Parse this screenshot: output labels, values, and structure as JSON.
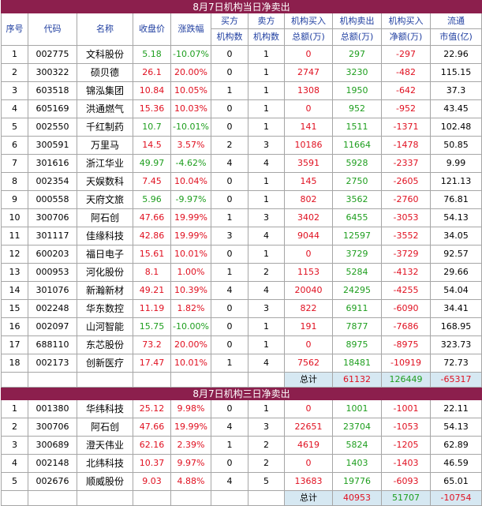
{
  "table1": {
    "title": "8月7日机构当日净卖出",
    "headers": {
      "seq": "序号",
      "code": "代码",
      "name": "名称",
      "close": "收盘价",
      "change": "涨跌幅",
      "buyers_top": "买方",
      "buyers_bot": "机构数",
      "sellers_top": "卖方",
      "sellers_bot": "机构数",
      "buy_amt_top": "机构买入",
      "buy_amt_bot": "总额(万)",
      "sell_amt_top": "机构卖出",
      "sell_amt_bot": "总额(万)",
      "net_top": "机构买入",
      "net_bot": "净额(万)",
      "cap_top": "流通",
      "cap_bot": "市值(亿)"
    },
    "rows": [
      {
        "seq": "1",
        "code": "002775",
        "name": "文科股份",
        "close": "5.18",
        "change": "-10.07%",
        "dir": "down",
        "buyers": "0",
        "sellers": "1",
        "buy": "0",
        "sell": "297",
        "net": "-297",
        "cap": "22.96"
      },
      {
        "seq": "2",
        "code": "300322",
        "name": "硕贝德",
        "close": "26.1",
        "change": "20.00%",
        "dir": "up",
        "buyers": "0",
        "sellers": "1",
        "buy": "2747",
        "sell": "3230",
        "net": "-482",
        "cap": "115.15"
      },
      {
        "seq": "3",
        "code": "603518",
        "name": "锦泓集团",
        "close": "10.84",
        "change": "10.05%",
        "dir": "up",
        "buyers": "1",
        "sellers": "1",
        "buy": "1308",
        "sell": "1950",
        "net": "-642",
        "cap": "37.3"
      },
      {
        "seq": "4",
        "code": "605169",
        "name": "洪通燃气",
        "close": "15.36",
        "change": "10.03%",
        "dir": "up",
        "buyers": "0",
        "sellers": "1",
        "buy": "0",
        "sell": "952",
        "net": "-952",
        "cap": "43.45"
      },
      {
        "seq": "5",
        "code": "002550",
        "name": "千红制药",
        "close": "10.7",
        "change": "-10.01%",
        "dir": "down",
        "buyers": "0",
        "sellers": "1",
        "buy": "141",
        "sell": "1511",
        "net": "-1371",
        "cap": "102.48"
      },
      {
        "seq": "6",
        "code": "300591",
        "name": "万里马",
        "close": "14.5",
        "change": "3.57%",
        "dir": "up",
        "buyers": "2",
        "sellers": "3",
        "buy": "10186",
        "sell": "11664",
        "net": "-1478",
        "cap": "50.85"
      },
      {
        "seq": "7",
        "code": "301616",
        "name": "浙江华业",
        "close": "49.97",
        "change": "-4.62%",
        "dir": "down",
        "buyers": "4",
        "sellers": "4",
        "buy": "3591",
        "sell": "5928",
        "net": "-2337",
        "cap": "9.99"
      },
      {
        "seq": "8",
        "code": "002354",
        "name": "天娱数科",
        "close": "7.45",
        "change": "10.04%",
        "dir": "up",
        "buyers": "0",
        "sellers": "1",
        "buy": "145",
        "sell": "2750",
        "net": "-2605",
        "cap": "121.13"
      },
      {
        "seq": "9",
        "code": "000558",
        "name": "天府文旅",
        "close": "5.96",
        "change": "-9.97%",
        "dir": "down",
        "buyers": "0",
        "sellers": "1",
        "buy": "802",
        "sell": "3562",
        "net": "-2760",
        "cap": "76.81"
      },
      {
        "seq": "10",
        "code": "300706",
        "name": "阿石创",
        "close": "47.66",
        "change": "19.99%",
        "dir": "up",
        "buyers": "1",
        "sellers": "3",
        "buy": "3402",
        "sell": "6455",
        "net": "-3053",
        "cap": "54.13"
      },
      {
        "seq": "11",
        "code": "301117",
        "name": "佳缘科技",
        "close": "42.86",
        "change": "19.99%",
        "dir": "up",
        "buyers": "3",
        "sellers": "4",
        "buy": "9044",
        "sell": "12597",
        "net": "-3552",
        "cap": "34.05"
      },
      {
        "seq": "12",
        "code": "600203",
        "name": "福日电子",
        "close": "15.61",
        "change": "10.01%",
        "dir": "up",
        "buyers": "0",
        "sellers": "1",
        "buy": "0",
        "sell": "3729",
        "net": "-3729",
        "cap": "92.57"
      },
      {
        "seq": "13",
        "code": "000953",
        "name": "河化股份",
        "close": "8.1",
        "change": "1.00%",
        "dir": "up",
        "buyers": "1",
        "sellers": "2",
        "buy": "1153",
        "sell": "5284",
        "net": "-4132",
        "cap": "29.66"
      },
      {
        "seq": "14",
        "code": "301076",
        "name": "新瀚新材",
        "close": "49.21",
        "change": "10.39%",
        "dir": "up",
        "buyers": "4",
        "sellers": "4",
        "buy": "20040",
        "sell": "24295",
        "net": "-4255",
        "cap": "54.04"
      },
      {
        "seq": "15",
        "code": "002248",
        "name": "华东数控",
        "close": "11.19",
        "change": "1.82%",
        "dir": "up",
        "buyers": "0",
        "sellers": "3",
        "buy": "822",
        "sell": "6911",
        "net": "-6090",
        "cap": "34.41"
      },
      {
        "seq": "16",
        "code": "002097",
        "name": "山河智能",
        "close": "15.75",
        "change": "-10.00%",
        "dir": "down",
        "buyers": "0",
        "sellers": "1",
        "buy": "191",
        "sell": "7877",
        "net": "-7686",
        "cap": "168.95"
      },
      {
        "seq": "17",
        "code": "688110",
        "name": "东芯股份",
        "close": "73.2",
        "change": "20.00%",
        "dir": "up",
        "buyers": "0",
        "sellers": "1",
        "buy": "0",
        "sell": "8975",
        "net": "-8975",
        "cap": "323.73"
      },
      {
        "seq": "18",
        "code": "002173",
        "name": "创新医疗",
        "close": "17.47",
        "change": "10.01%",
        "dir": "up",
        "buyers": "1",
        "sellers": "4",
        "buy": "7562",
        "sell": "18481",
        "net": "-10919",
        "cap": "72.73"
      }
    ],
    "total": {
      "label": "总计",
      "buy": "61132",
      "sell": "126449",
      "net": "-65317"
    }
  },
  "table2": {
    "title": "8月7日机构三日净卖出",
    "rows": [
      {
        "seq": "1",
        "code": "001380",
        "name": "华纬科技",
        "close": "25.12",
        "change": "9.98%",
        "dir": "up",
        "buyers": "0",
        "sellers": "1",
        "buy": "0",
        "sell": "1001",
        "net": "-1001",
        "cap": "22.11"
      },
      {
        "seq": "2",
        "code": "300706",
        "name": "阿石创",
        "close": "47.66",
        "change": "19.99%",
        "dir": "up",
        "buyers": "4",
        "sellers": "3",
        "buy": "22651",
        "sell": "23704",
        "net": "-1053",
        "cap": "54.13"
      },
      {
        "seq": "3",
        "code": "300689",
        "name": "澄天伟业",
        "close": "62.16",
        "change": "2.39%",
        "dir": "up",
        "buyers": "1",
        "sellers": "2",
        "buy": "4619",
        "sell": "5824",
        "net": "-1205",
        "cap": "62.89"
      },
      {
        "seq": "4",
        "code": "002148",
        "name": "北纬科技",
        "close": "10.37",
        "change": "9.97%",
        "dir": "up",
        "buyers": "0",
        "sellers": "2",
        "buy": "0",
        "sell": "1403",
        "net": "-1403",
        "cap": "46.59"
      },
      {
        "seq": "5",
        "code": "002676",
        "name": "顺威股份",
        "close": "9.03",
        "change": "4.88%",
        "dir": "up",
        "buyers": "4",
        "sellers": "5",
        "buy": "13683",
        "sell": "19776",
        "net": "-6093",
        "cap": "65.01"
      }
    ],
    "total": {
      "label": "总计",
      "buy": "40953",
      "sell": "51707",
      "net": "-10754"
    }
  },
  "colors": {
    "title_bg": "#8c1f4d",
    "up": "#e01020",
    "down": "#1e9e1e",
    "header_text": "#1f3ea0",
    "total_bg": "#d6e8f2"
  }
}
